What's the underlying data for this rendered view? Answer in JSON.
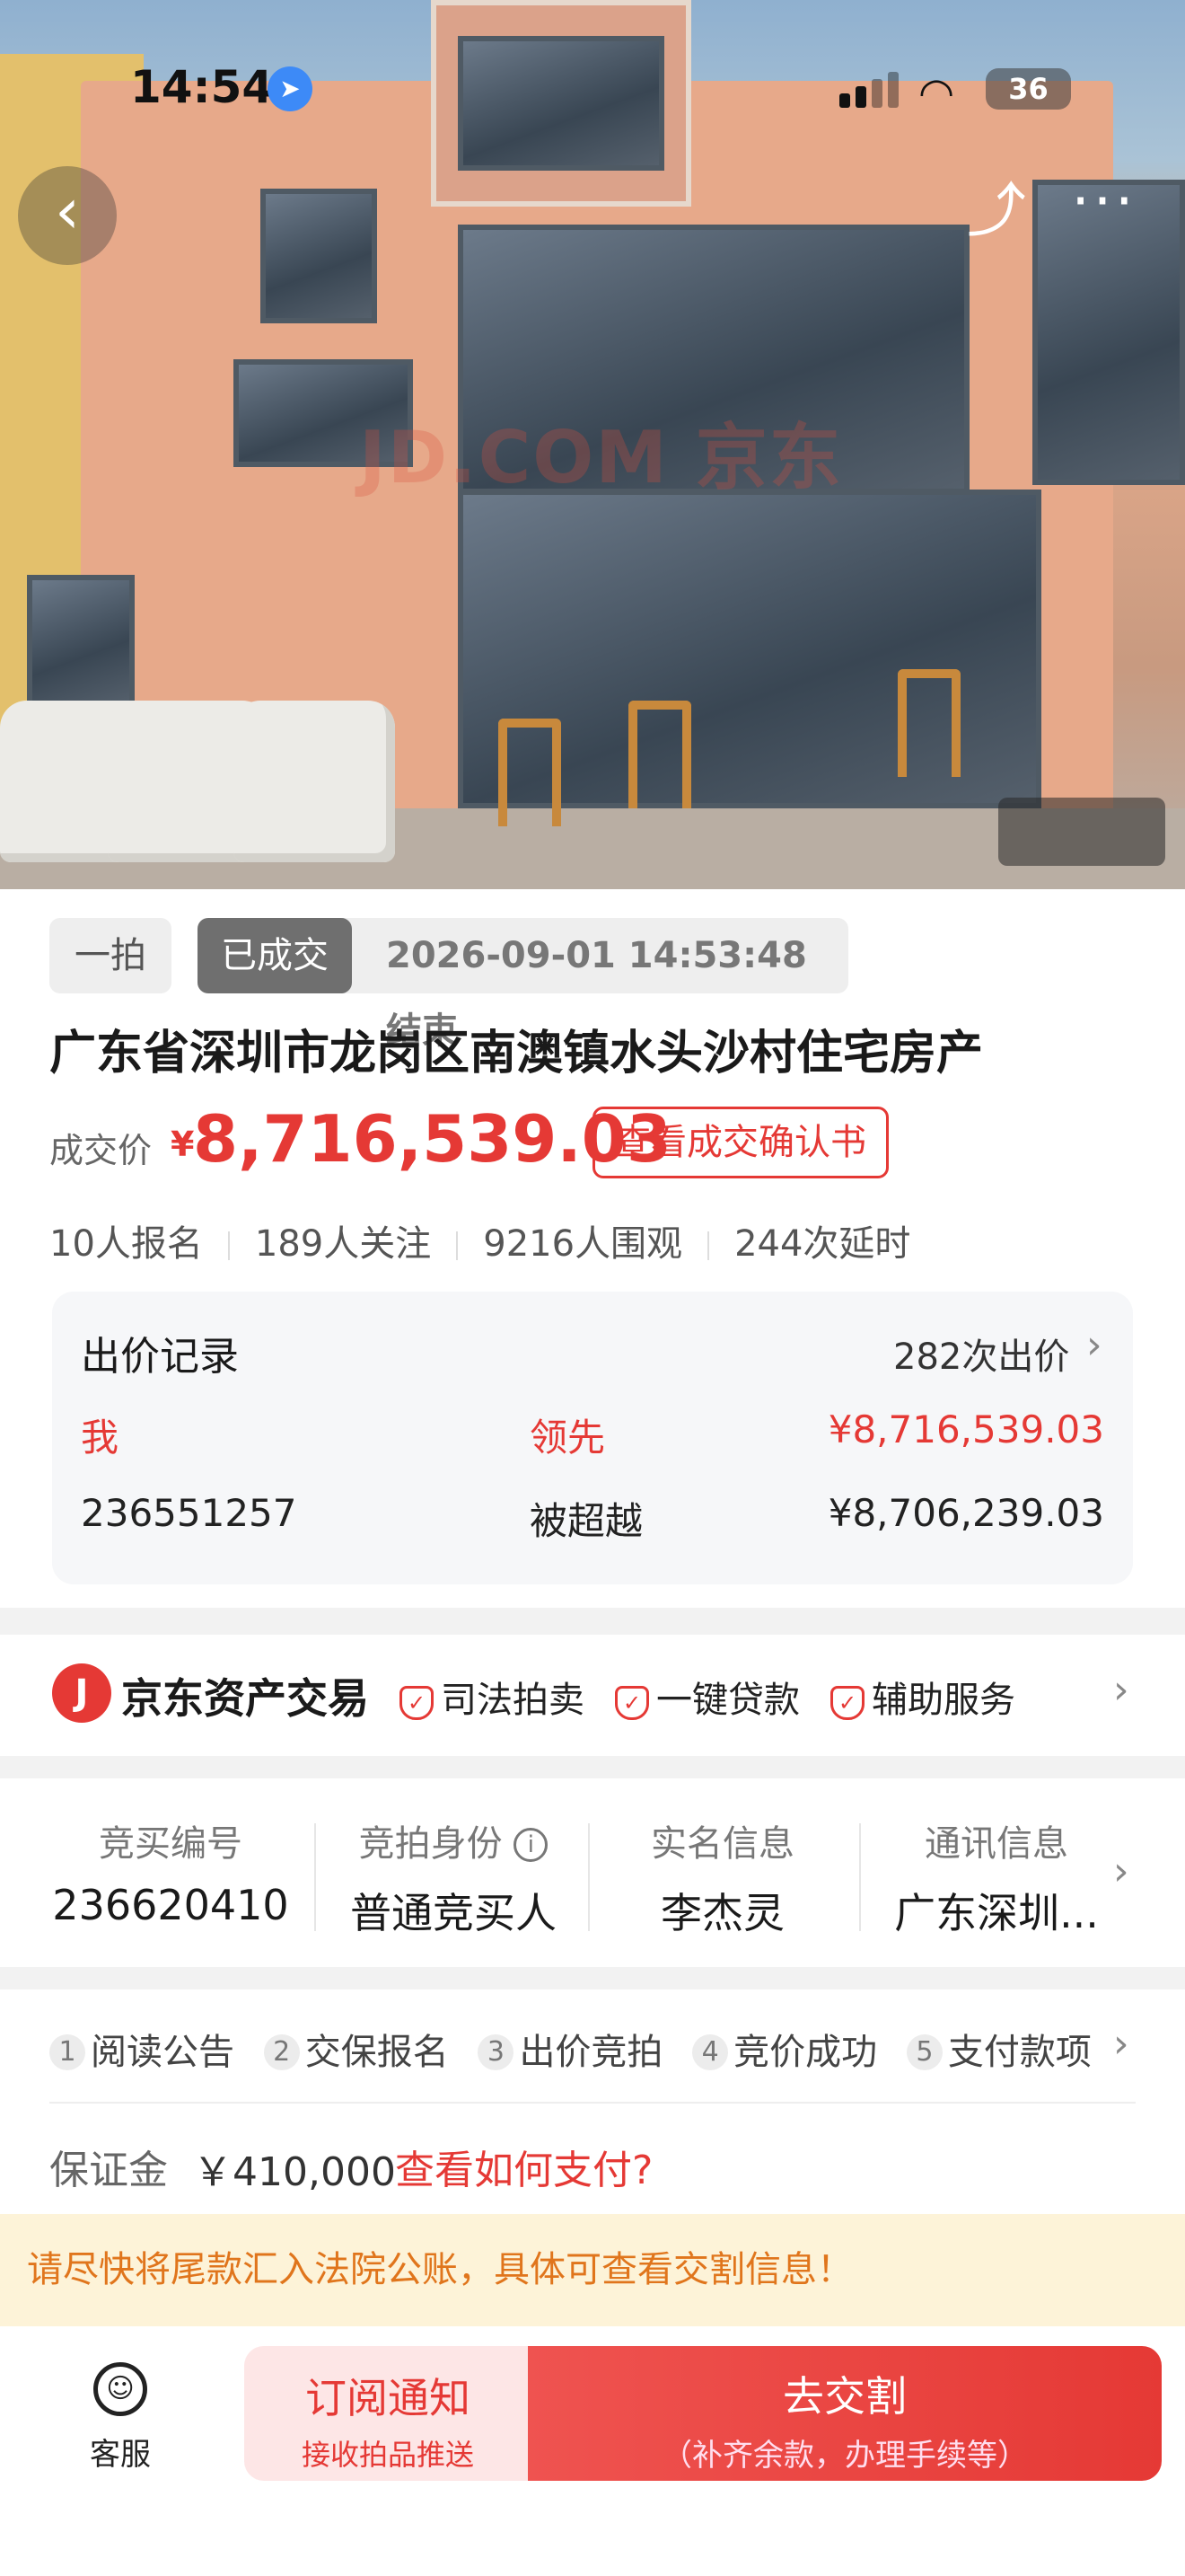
{
  "status_bar": {
    "time": "14:54",
    "battery": "36"
  },
  "hero": {
    "watermark": "JD.COM 京东"
  },
  "auction": {
    "round_tag": "一拍",
    "status_tag": "已成交",
    "end_time": "2026-09-01 14:53:48结束",
    "title": "广东省深圳市龙岗区南澳镇水头沙村住宅房产",
    "price_label": "成交价",
    "currency": "¥",
    "price": "8,716,539.03",
    "confirm_button": "查看成交确认书",
    "stats": [
      "10人报名",
      "189人关注",
      "9216人围观",
      "244次延时"
    ]
  },
  "bid_record": {
    "title": "出价记录",
    "count": "282次出价",
    "rows": [
      {
        "bidder": "我",
        "status": "领先",
        "amount": "¥8,716,539.03"
      },
      {
        "bidder": "236551257",
        "status": "被超越",
        "amount": "¥8,706,239.03"
      }
    ]
  },
  "brand": {
    "logo": "J",
    "name": "京东资产交易",
    "services": [
      "司法拍卖",
      "一键贷款",
      "辅助服务"
    ]
  },
  "bidder_info": {
    "columns": [
      {
        "label": "竞买编号",
        "value": "236620410"
      },
      {
        "label": "竞拍身份",
        "value": "普通竞买人"
      },
      {
        "label": "实名信息",
        "value": "李杰灵"
      },
      {
        "label": "通讯信息",
        "value": "广东深圳..."
      }
    ]
  },
  "steps": [
    {
      "num": "1",
      "label": "阅读公告"
    },
    {
      "num": "2",
      "label": "交保报名"
    },
    {
      "num": "3",
      "label": "出价竞拍"
    },
    {
      "num": "4",
      "label": "竞价成功"
    },
    {
      "num": "5",
      "label": "支付款项"
    }
  ],
  "deposit": {
    "label": "保证金",
    "value": "￥410,000",
    "link": "查看如何支付?"
  },
  "notice": "请尽快将尾款汇入法院公账，具体可查看交割信息！",
  "bottom": {
    "service_label": "客服",
    "subscribe_main": "订阅通知",
    "subscribe_sub": "接收拍品推送",
    "pay_main": "去交割",
    "pay_sub": "（补齐余款，办理手续等）"
  },
  "colors": {
    "accent": "#e53935",
    "notice_bg": "#fdf3d8",
    "notice_text": "#e0751c"
  }
}
